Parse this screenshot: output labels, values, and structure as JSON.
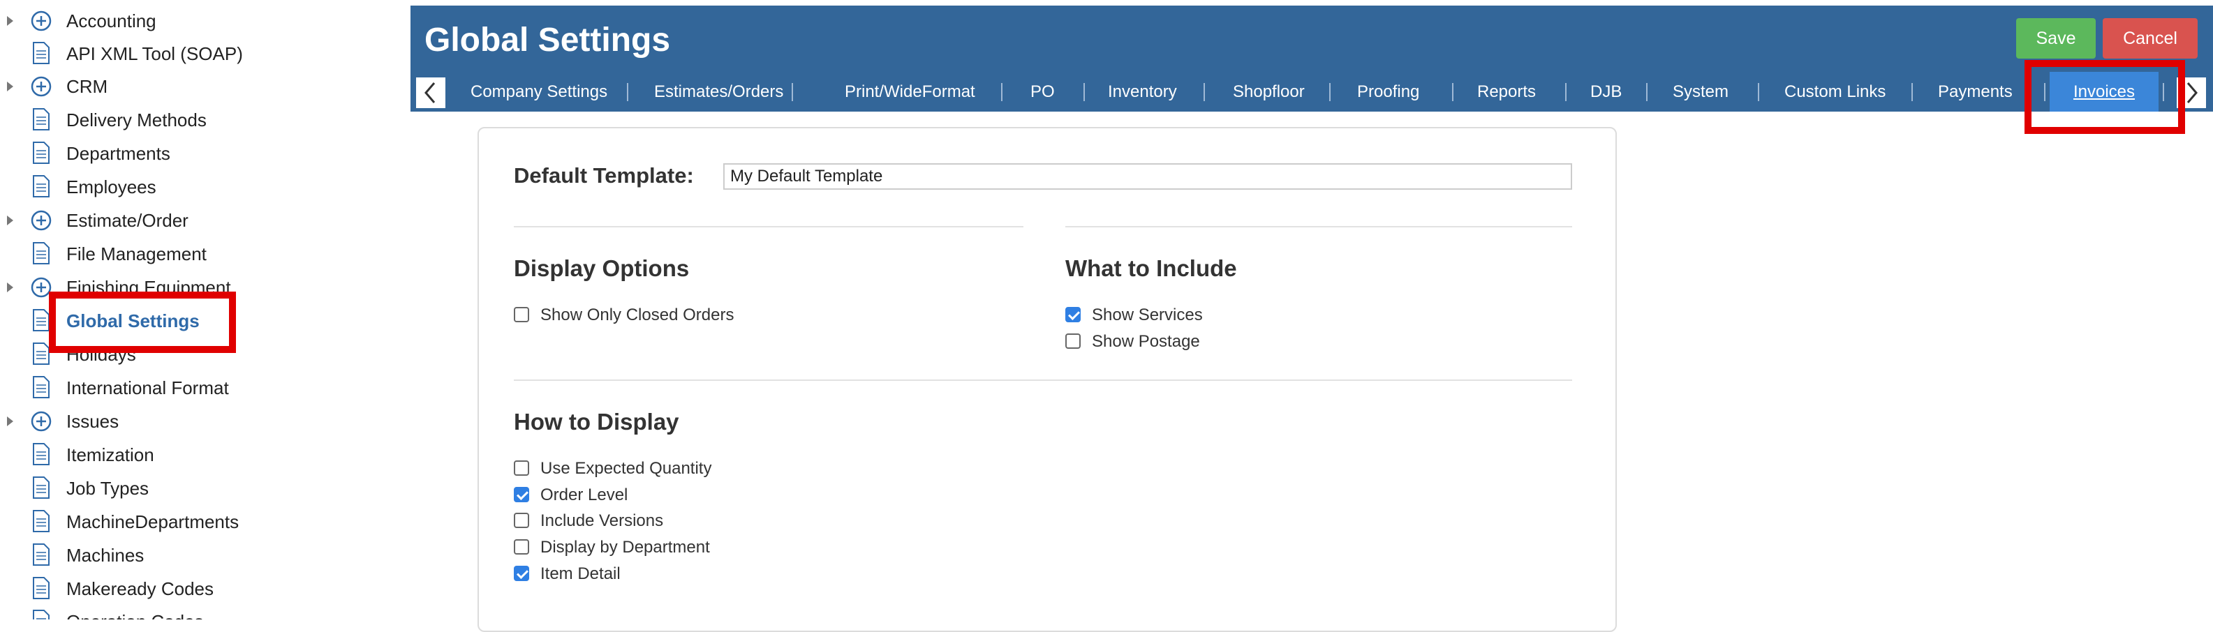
{
  "sidebar": {
    "items": [
      {
        "label": "Accounting",
        "type": "folder"
      },
      {
        "label": "API XML Tool (SOAP)",
        "type": "doc"
      },
      {
        "label": "CRM",
        "type": "folder"
      },
      {
        "label": "Delivery Methods",
        "type": "doc"
      },
      {
        "label": "Departments",
        "type": "doc"
      },
      {
        "label": "Employees",
        "type": "doc"
      },
      {
        "label": "Estimate/Order",
        "type": "folder"
      },
      {
        "label": "File Management",
        "type": "doc"
      },
      {
        "label": "Finishing Equipment",
        "type": "folder"
      },
      {
        "label": "Global Settings",
        "type": "doc",
        "selected": true
      },
      {
        "label": "Holidays",
        "type": "doc"
      },
      {
        "label": "International Format",
        "type": "doc"
      },
      {
        "label": "Issues",
        "type": "folder"
      },
      {
        "label": "Itemization",
        "type": "doc"
      },
      {
        "label": "Job Types",
        "type": "doc"
      },
      {
        "label": "MachineDepartments",
        "type": "doc"
      },
      {
        "label": "Machines",
        "type": "doc"
      },
      {
        "label": "Makeready Codes",
        "type": "doc"
      },
      {
        "label": "Operation Codes",
        "type": "doc"
      }
    ]
  },
  "header": {
    "title": "Global Settings",
    "save_label": "Save",
    "cancel_label": "Cancel"
  },
  "tabs": [
    {
      "label": "Company Settings"
    },
    {
      "label": "Estimates/Orders"
    },
    {
      "label": "Print/WideFormat"
    },
    {
      "label": "PO"
    },
    {
      "label": "Inventory"
    },
    {
      "label": "Shopfloor"
    },
    {
      "label": "Proofing"
    },
    {
      "label": "Reports"
    },
    {
      "label": "DJB"
    },
    {
      "label": "System"
    },
    {
      "label": "Custom Links"
    },
    {
      "label": "Payments"
    },
    {
      "label": "Invoices",
      "active": true
    }
  ],
  "form": {
    "default_template_label": "Default Template:",
    "default_template_value": "My Default Template",
    "display_options": {
      "title": "Display Options",
      "options": [
        {
          "label": "Show Only Closed Orders",
          "checked": false
        }
      ]
    },
    "what_to_include": {
      "title": "What to Include",
      "options": [
        {
          "label": "Show Services",
          "checked": true
        },
        {
          "label": "Show Postage",
          "checked": false
        }
      ]
    },
    "how_to_display": {
      "title": "How to Display",
      "options": [
        {
          "label": "Use Expected Quantity",
          "checked": false
        },
        {
          "label": "Order Level",
          "checked": true
        },
        {
          "label": "Include Versions",
          "checked": false
        },
        {
          "label": "Display by Department",
          "checked": false
        },
        {
          "label": "Item Detail",
          "checked": true
        }
      ]
    }
  },
  "colors": {
    "header_bg": "#336699",
    "active_tab": "#3b86d9",
    "save": "#5cb85c",
    "cancel": "#d9534f",
    "highlight": "#e00000",
    "checkbox_checked": "#2f7fe3"
  }
}
